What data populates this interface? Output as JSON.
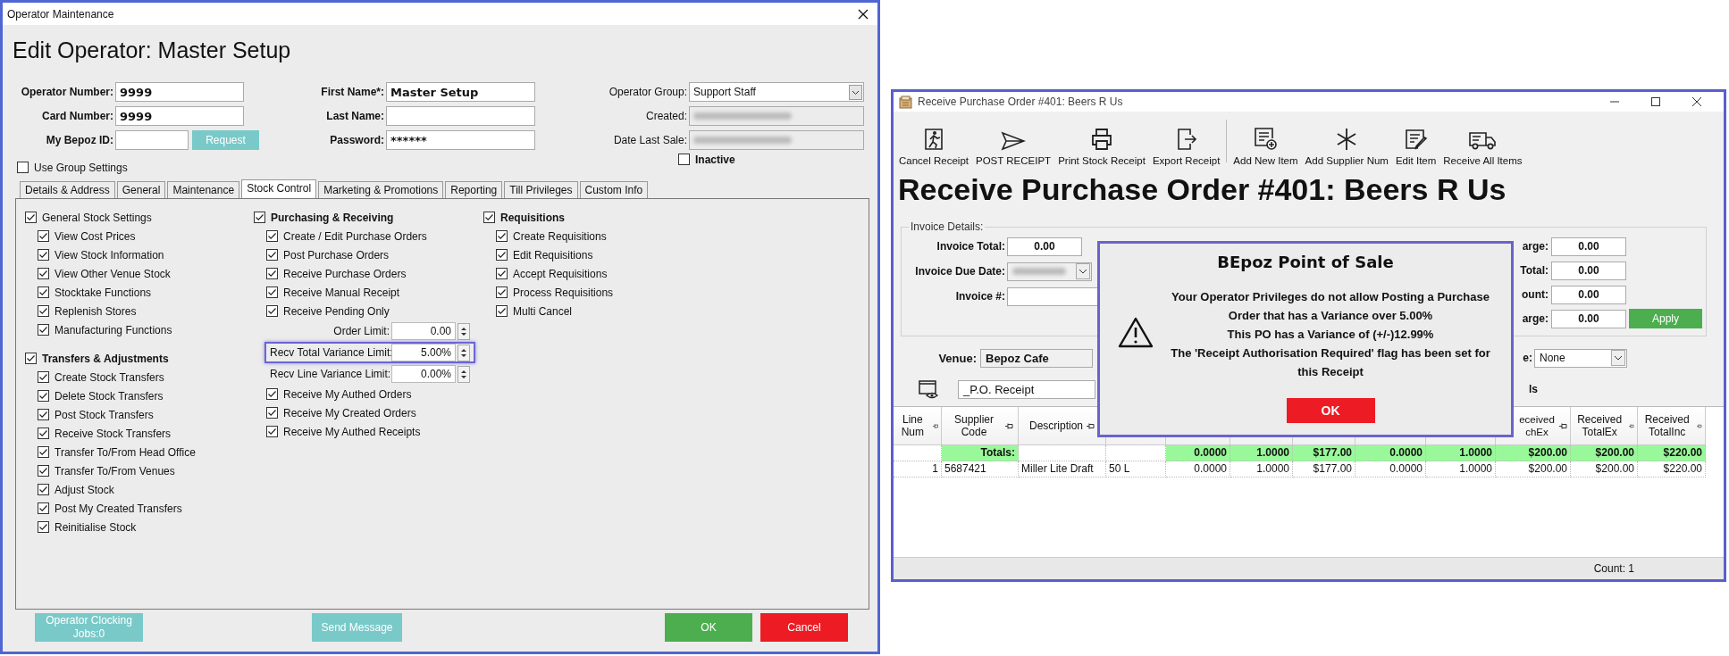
{
  "operator_window": {
    "title": "Operator Maintenance",
    "heading": "Edit Operator: Master Setup",
    "id_fields": [
      {
        "label": "Operator Number:",
        "value": "9999"
      },
      {
        "label": "Card Number:",
        "value": "9999"
      },
      {
        "label": "My Bepoz ID:"
      }
    ],
    "request_button": "Request",
    "name_fields": [
      {
        "label": "First Name*:",
        "value": "Master Setup"
      },
      {
        "label": "Last Name:"
      },
      {
        "label": "Password:",
        "value": "******"
      }
    ],
    "operator_group": {
      "label": "Operator Group:",
      "value": "Support Staff"
    },
    "info_fields": [
      {
        "label": "Created:"
      },
      {
        "label": "Date Last Sale:"
      }
    ],
    "inactive": {
      "label": "Inactive",
      "checked": false
    },
    "use_group_settings": {
      "label": "Use Group Settings",
      "checked": false
    },
    "tabs": [
      {
        "label": "Details & Address",
        "selected": false
      },
      {
        "label": "General",
        "selected": false
      },
      {
        "label": "Maintenance",
        "selected": false
      },
      {
        "label": "Stock Control",
        "selected": true
      },
      {
        "label": "Marketing & Promotions",
        "selected": false
      },
      {
        "label": "Reporting",
        "selected": false
      },
      {
        "label": "Till Privileges",
        "selected": false
      },
      {
        "label": "Custom Info",
        "selected": false
      }
    ],
    "panel_columns": [
      [
        {
          "kind": "group",
          "label": "General Stock Settings",
          "checked": true
        },
        {
          "kind": "item",
          "label": "View Cost Prices",
          "checked": true
        },
        {
          "kind": "item",
          "label": "View Stock Information",
          "checked": true
        },
        {
          "kind": "item",
          "label": "View Other Venue Stock",
          "checked": true
        },
        {
          "kind": "item",
          "label": "Stocktake Functions",
          "checked": true
        },
        {
          "kind": "item",
          "label": "Replenish Stores",
          "checked": true
        },
        {
          "kind": "item",
          "label": "Manufacturing Functions",
          "checked": true
        },
        {
          "kind": "heading",
          "label": "Transfers & Adjustments",
          "checked": true
        },
        {
          "kind": "item",
          "label": "Create Stock Transfers",
          "checked": true
        },
        {
          "kind": "item",
          "label": "Delete Stock Transfers",
          "checked": true
        },
        {
          "kind": "item",
          "label": "Post Stock Transfers",
          "checked": true
        },
        {
          "kind": "item",
          "label": "Receive Stock Transfers",
          "checked": true
        },
        {
          "kind": "item",
          "label": "Transfer To/From Head Office",
          "checked": true
        },
        {
          "kind": "item",
          "label": "Transfer To/From Venues",
          "checked": true
        },
        {
          "kind": "item",
          "label": "Adjust Stock",
          "checked": true
        },
        {
          "kind": "item",
          "label": "Post My Created Transfers",
          "checked": true
        },
        {
          "kind": "item",
          "label": "Reinitialise Stock",
          "checked": true
        }
      ],
      [
        {
          "kind": "heading",
          "label": "Purchasing & Receiving",
          "checked": true
        },
        {
          "kind": "item",
          "label": "Create / Edit Purchase Orders",
          "checked": true
        },
        {
          "kind": "item",
          "label": "Post Purchase Orders",
          "checked": true
        },
        {
          "kind": "item",
          "label": "Receive Purchase Orders",
          "checked": true
        },
        {
          "kind": "item",
          "label": "Receive Manual Receipt",
          "checked": true
        },
        {
          "kind": "item",
          "label": "Receive Pending Only",
          "checked": true
        },
        {
          "kind": "spin",
          "label": "Order Limit:",
          "value": "0.00",
          "highlighted": false
        },
        {
          "kind": "spin",
          "label": "Recv Total Variance Limit:",
          "value": "5.00%",
          "highlighted": true
        },
        {
          "kind": "spin",
          "label": "Recv Line Variance Limit:",
          "value": "0.00%",
          "highlighted": false
        },
        {
          "kind": "item",
          "label": "Receive My Authed Orders",
          "checked": true
        },
        {
          "kind": "item",
          "label": "Receive My Created Orders",
          "checked": true
        },
        {
          "kind": "item",
          "label": "Receive My Authed Receipts",
          "checked": true
        }
      ],
      [
        {
          "kind": "heading",
          "label": "Requisitions",
          "checked": true
        },
        {
          "kind": "item",
          "label": "Create Requisitions",
          "checked": true
        },
        {
          "kind": "item",
          "label": "Edit Requisitions",
          "checked": true
        },
        {
          "kind": "item",
          "label": "Accept Requisitions",
          "checked": true
        },
        {
          "kind": "item",
          "label": "Process Requisitions",
          "checked": true
        },
        {
          "kind": "item",
          "label": "Multi Cancel",
          "checked": true
        }
      ]
    ],
    "buttons": [
      {
        "kind": "secondary",
        "label": "Operator Clocking Jobs:0"
      },
      {
        "kind": "secondary",
        "label": "Send Message"
      },
      {
        "kind": "confirm",
        "label": "OK"
      },
      {
        "kind": "cancel",
        "label": "Cancel"
      }
    ]
  },
  "receive_window": {
    "title": "Receive Purchase Order #401: Beers R Us",
    "toolbar_groups": [
      [
        "Cancel Receipt",
        "POST RECEIPT",
        "Print Stock Receipt",
        "Export Receipt"
      ],
      [
        "Add New Item",
        "Add Supplier Num",
        "Edit Item",
        "Receive All Items"
      ]
    ],
    "heading": "Receive Purchase Order #401: Beers R Us",
    "invoice_details": {
      "legend": "Invoice Details:",
      "left_fields": [
        {
          "kind": "text",
          "label": "Invoice Total:",
          "value": "0.00"
        },
        {
          "kind": "date",
          "label": "Invoice Due Date:"
        },
        {
          "kind": "text",
          "label": "Invoice #:"
        }
      ],
      "right_fields": [
        {
          "label": "arge:",
          "value": "0.00"
        },
        {
          "label": "Total:",
          "value": "0.00"
        },
        {
          "label": "ount:",
          "value": "0.00"
        },
        {
          "label": "arge:",
          "value": "0.00"
        }
      ],
      "apply_button": "Apply"
    },
    "venue": {
      "label": "Venue:",
      "value": "Bepoz Cafe"
    },
    "right_select": {
      "label": "e:",
      "value": "None"
    },
    "receipt_type": "_P.O. Receipt",
    "fragment": "ls",
    "table": {
      "columns": [
        {
          "label": "Line Num"
        },
        {
          "label": "Supplier Code"
        },
        {
          "label": "Description"
        },
        {},
        {},
        {},
        {},
        {},
        {},
        {
          "label": "eceived chEx"
        },
        {
          "label": "Received TotalEx"
        },
        {
          "label": "Received TotalInc"
        }
      ],
      "totals": {
        "label": "Totals:",
        "values": [
          "0.0000",
          "1.0000",
          "$177.00",
          "0.0000",
          "1.0000",
          "$200.00",
          "$200.00",
          "$220.00"
        ]
      },
      "rows": [
        [
          "1",
          "5687421",
          "Miller Lite Draft",
          "50 L",
          "0.0000",
          "1.0000",
          "$177.00",
          "0.0000",
          "1.0000",
          "$200.00",
          "$200.00",
          "$220.00"
        ]
      ]
    },
    "status": "Count: 1",
    "dialog": {
      "title": "BEpoz Point of Sale",
      "message": [
        "Your Operator Privileges do not allow Posting a Purchase Order that has a Variance over 5.00%",
        "This PO has a Variance of (+/-)12.99%",
        "The 'Receipt Authorisation Required' flag has been set for this Receipt"
      ],
      "ok_button": "OK"
    }
  }
}
